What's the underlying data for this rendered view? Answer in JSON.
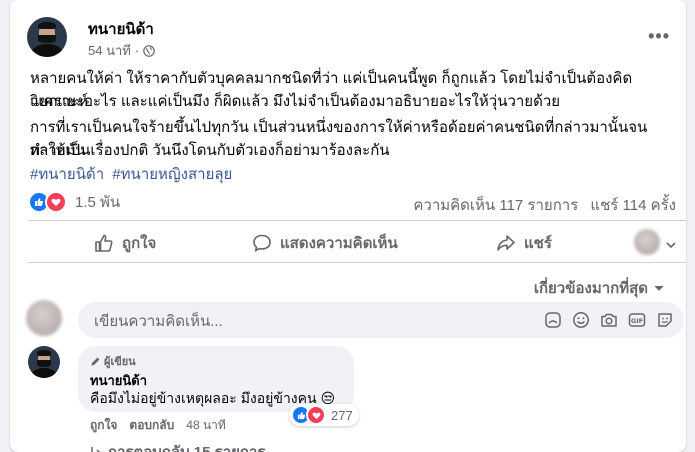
{
  "post": {
    "author": "ทนายนิด้า",
    "time": "54 นาที",
    "paragraphs": [
      "หลายคนให้ค่า ให้ราคากับตัวบุคคลมากชนิดที่ว่า แค่เป็นคนนี้พูด ก็ถูกแล้ว โดยไม่จำเป็นต้องคิด วิเคราะห์",
      "แยกแยะอะไร และแค่เป็นมึง ก็ผิดแล้ว มึงไม่จำเป็นต้องมาอธิบายอะไรให้วุ่นวายด้วย",
      "การที่เราเป็นคนใจร้ายขึ้นไปทุกวัน เป็นส่วนหนึ่งของการให้ค่าหรือด้อยค่าคนชนิดที่กล่าวมานั้นจนทำให้มัน",
      "กลายเป็นเรื่องปกติ วันนึงโดนกับตัวเองก็อย่ามาร้องละกัน"
    ],
    "hashtags": [
      "#ทนายนิด้า",
      "#ทนายหญิงสายลุย"
    ],
    "reaction_count": "1.5 พัน",
    "comments_count": "ความคิดเห็น 117 รายการ",
    "shares_count": "แชร์ 114 ครั้ง"
  },
  "actions": {
    "like": "ถูกใจ",
    "comment": "แสดงความคิดเห็น",
    "share": "แชร์"
  },
  "filter": "เกี่ยวข้องมากที่สุด",
  "comment_input": {
    "placeholder": "เขียนความคิดเห็น..."
  },
  "comment": {
    "author_tag": "ผู้เขียน",
    "author": "ทนายนิด้า",
    "text": "คือมึงไม่อยู่ข้างเหตุผลอะ มึงอยู่ข้างคน 😒",
    "reaction_count": "277",
    "like": "ถูกใจ",
    "reply": "ตอบกลับ",
    "time": "48 นาที",
    "replies": "การตอบกลับ 15 รายการ"
  },
  "colors": {
    "accent": "#1877f2",
    "love": "#f33e58",
    "hashtag": "#385898",
    "secondary_text": "#65676b"
  }
}
